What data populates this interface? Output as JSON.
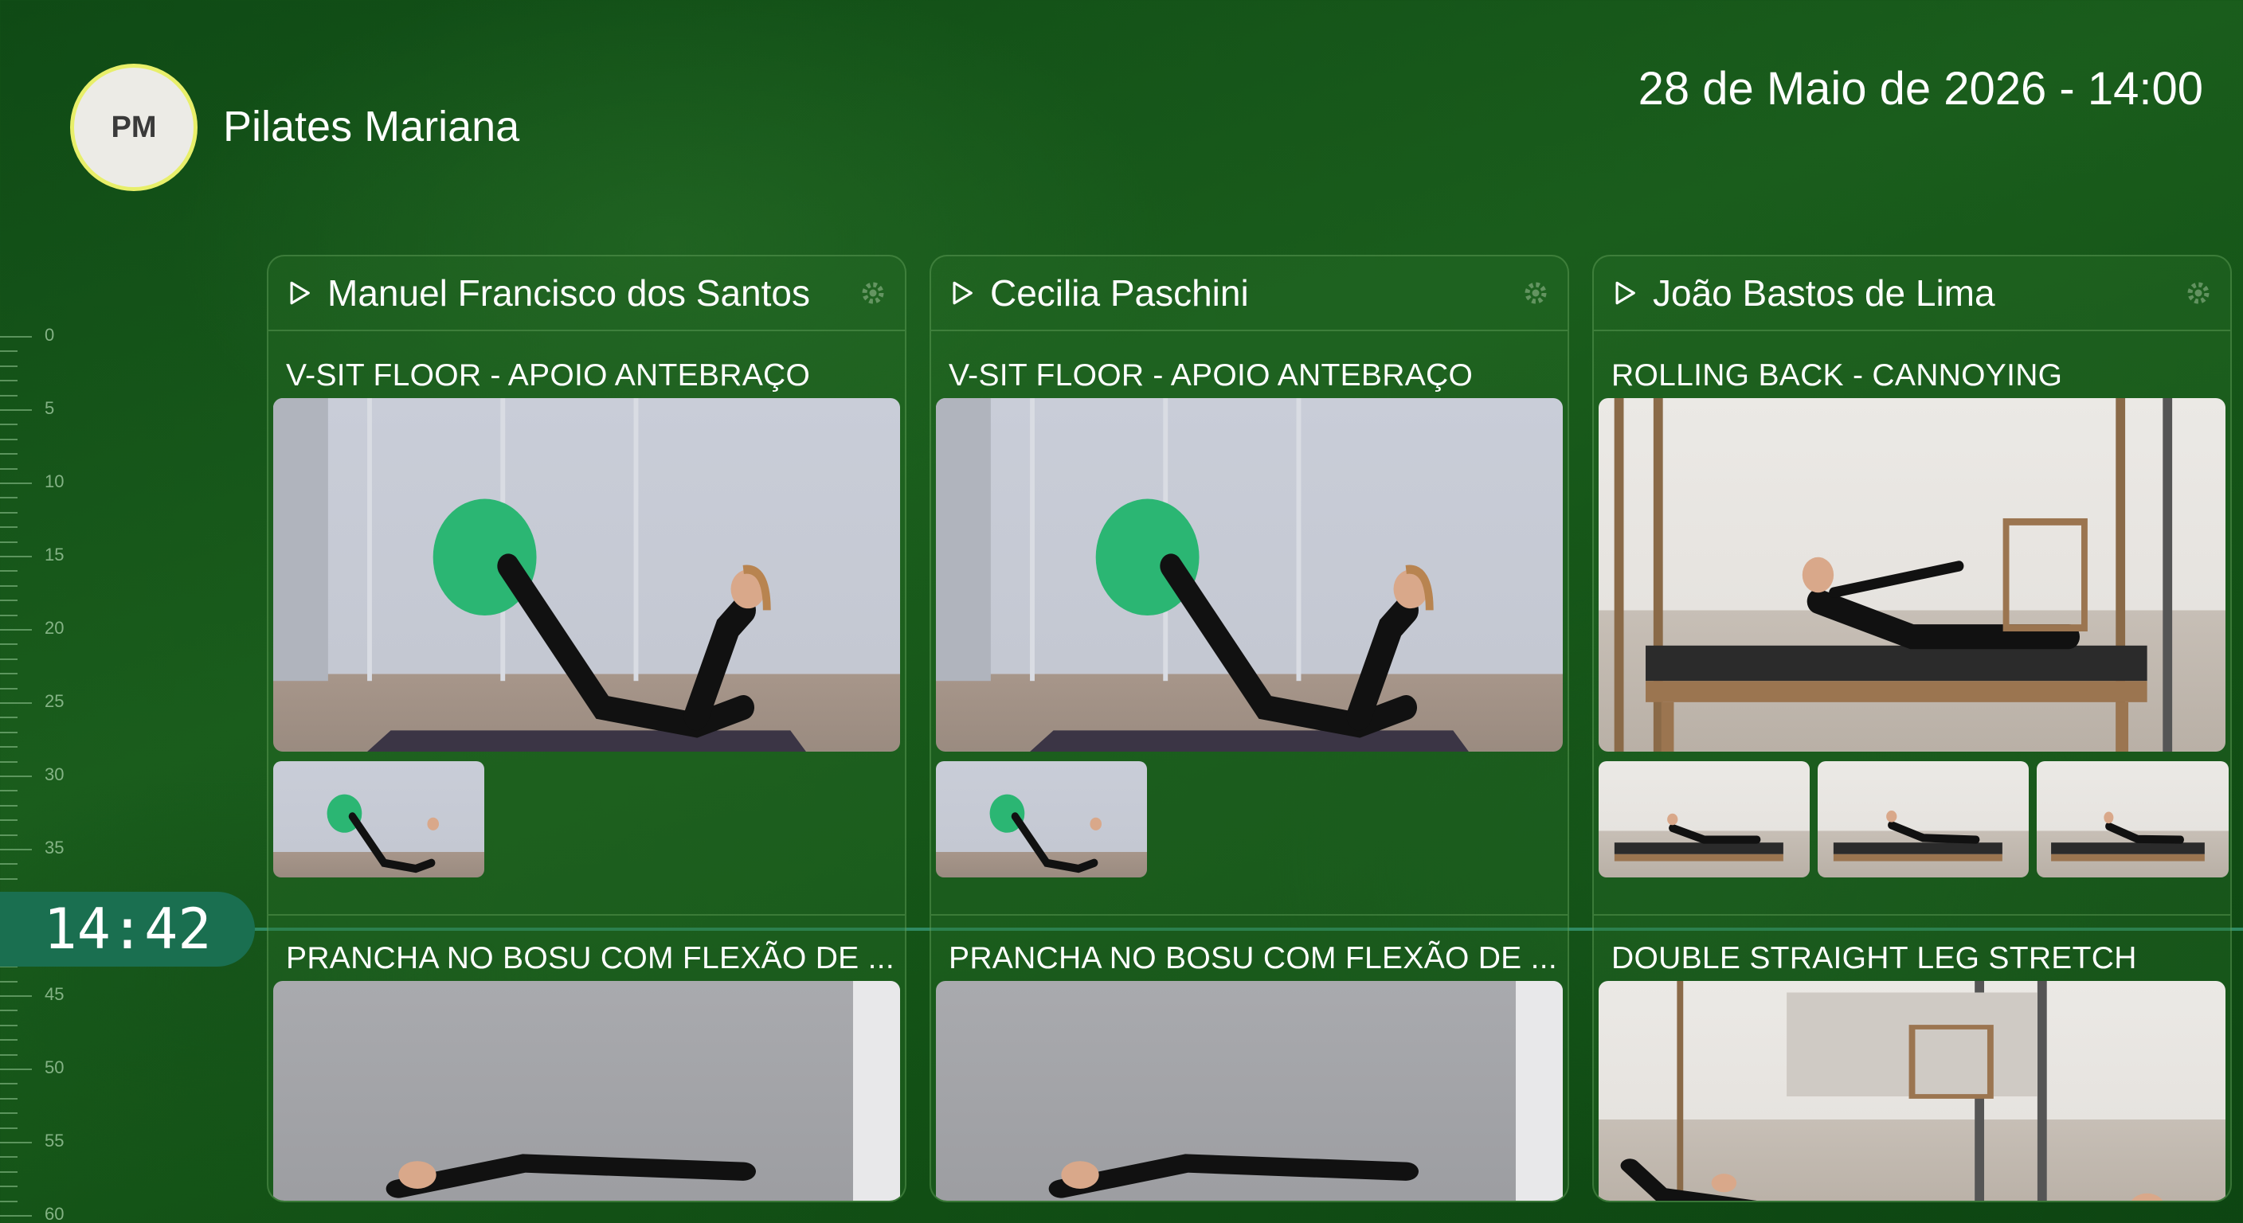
{
  "header": {
    "logo_initials": "PM",
    "studio_name": "Pilates Mariana",
    "datetime": "28 de Maio de 2026 - 14:00"
  },
  "timeline": {
    "current_time": "14:42",
    "tick_labels": [
      "0",
      "5",
      "10",
      "15",
      "20",
      "25",
      "30",
      "35",
      "45",
      "50",
      "55",
      "60"
    ],
    "line_color": "#2f8a63"
  },
  "columns": [
    {
      "client_name": "Manuel Francisco dos Santos",
      "exercises": [
        {
          "title": "V-SIT FLOOR - APOIO ANTEBRAÇO",
          "image": "woman doing v-sit on mat with green ball",
          "thumbnails": 1
        },
        {
          "title": "PRANCHA NO BOSU COM FLEXÃO DE ...",
          "image": "woman doing plank",
          "thumbnails": 0
        }
      ]
    },
    {
      "client_name": "Cecilia Paschini",
      "exercises": [
        {
          "title": "V-SIT FLOOR - APOIO ANTEBRAÇO",
          "image": "woman doing v-sit on mat with green ball",
          "thumbnails": 1
        },
        {
          "title": "PRANCHA NO BOSU COM FLEXÃO DE ...",
          "image": "woman doing plank",
          "thumbnails": 0
        }
      ]
    },
    {
      "client_name": "João Bastos de Lima",
      "exercises": [
        {
          "title": "ROLLING BACK - CANNOYING",
          "image": "woman on cadillac reformer",
          "thumbnails": 3
        },
        {
          "title": "DOUBLE STRAIGHT LEG STRETCH",
          "image": "woman on cadillac reformer",
          "thumbnails": 0
        }
      ]
    }
  ],
  "icons": {
    "play": "play-icon",
    "settings": "gear-icon"
  },
  "colors": {
    "background": "#1a5d1c",
    "logo_border": "#e8ef6a",
    "now_pill": "#1a6f50",
    "ball": "#2bb673"
  }
}
